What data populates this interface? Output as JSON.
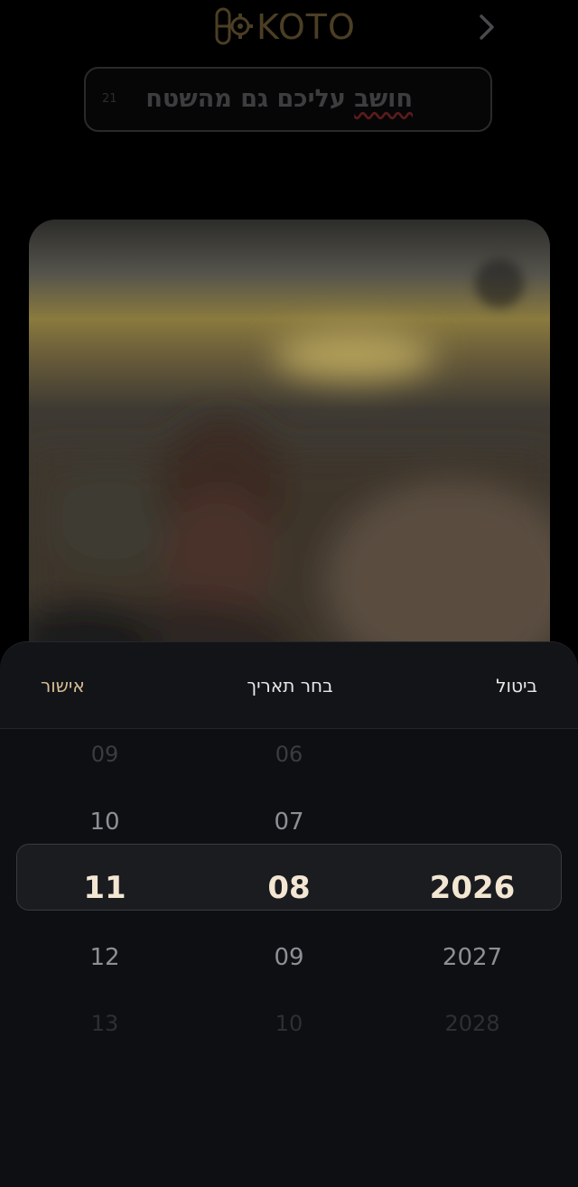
{
  "header": {
    "logo_text": "KOTO",
    "back_icon": "chevron-right-icon"
  },
  "post": {
    "title": "חושב עליכם גם מהשטח",
    "title_parts": [
      "חושב",
      " עליכם גם מהשטח"
    ],
    "char_count": "21"
  },
  "date_picker": {
    "confirm_label": "אישור",
    "title": "בחר תאריך",
    "cancel_label": "ביטול",
    "day_options": [
      "09",
      "10",
      "11",
      "12",
      "13"
    ],
    "month_options": [
      "06",
      "07",
      "08",
      "09",
      "10"
    ],
    "year_options": [
      "",
      "",
      "2026",
      "2027",
      "2028"
    ],
    "selected": {
      "day": "11",
      "month": "08",
      "year": "2026"
    }
  },
  "colors": {
    "accent_gold": "#d7bd95",
    "sheet_background": "#0d0f13",
    "selected_text": "#f3e6d2"
  }
}
